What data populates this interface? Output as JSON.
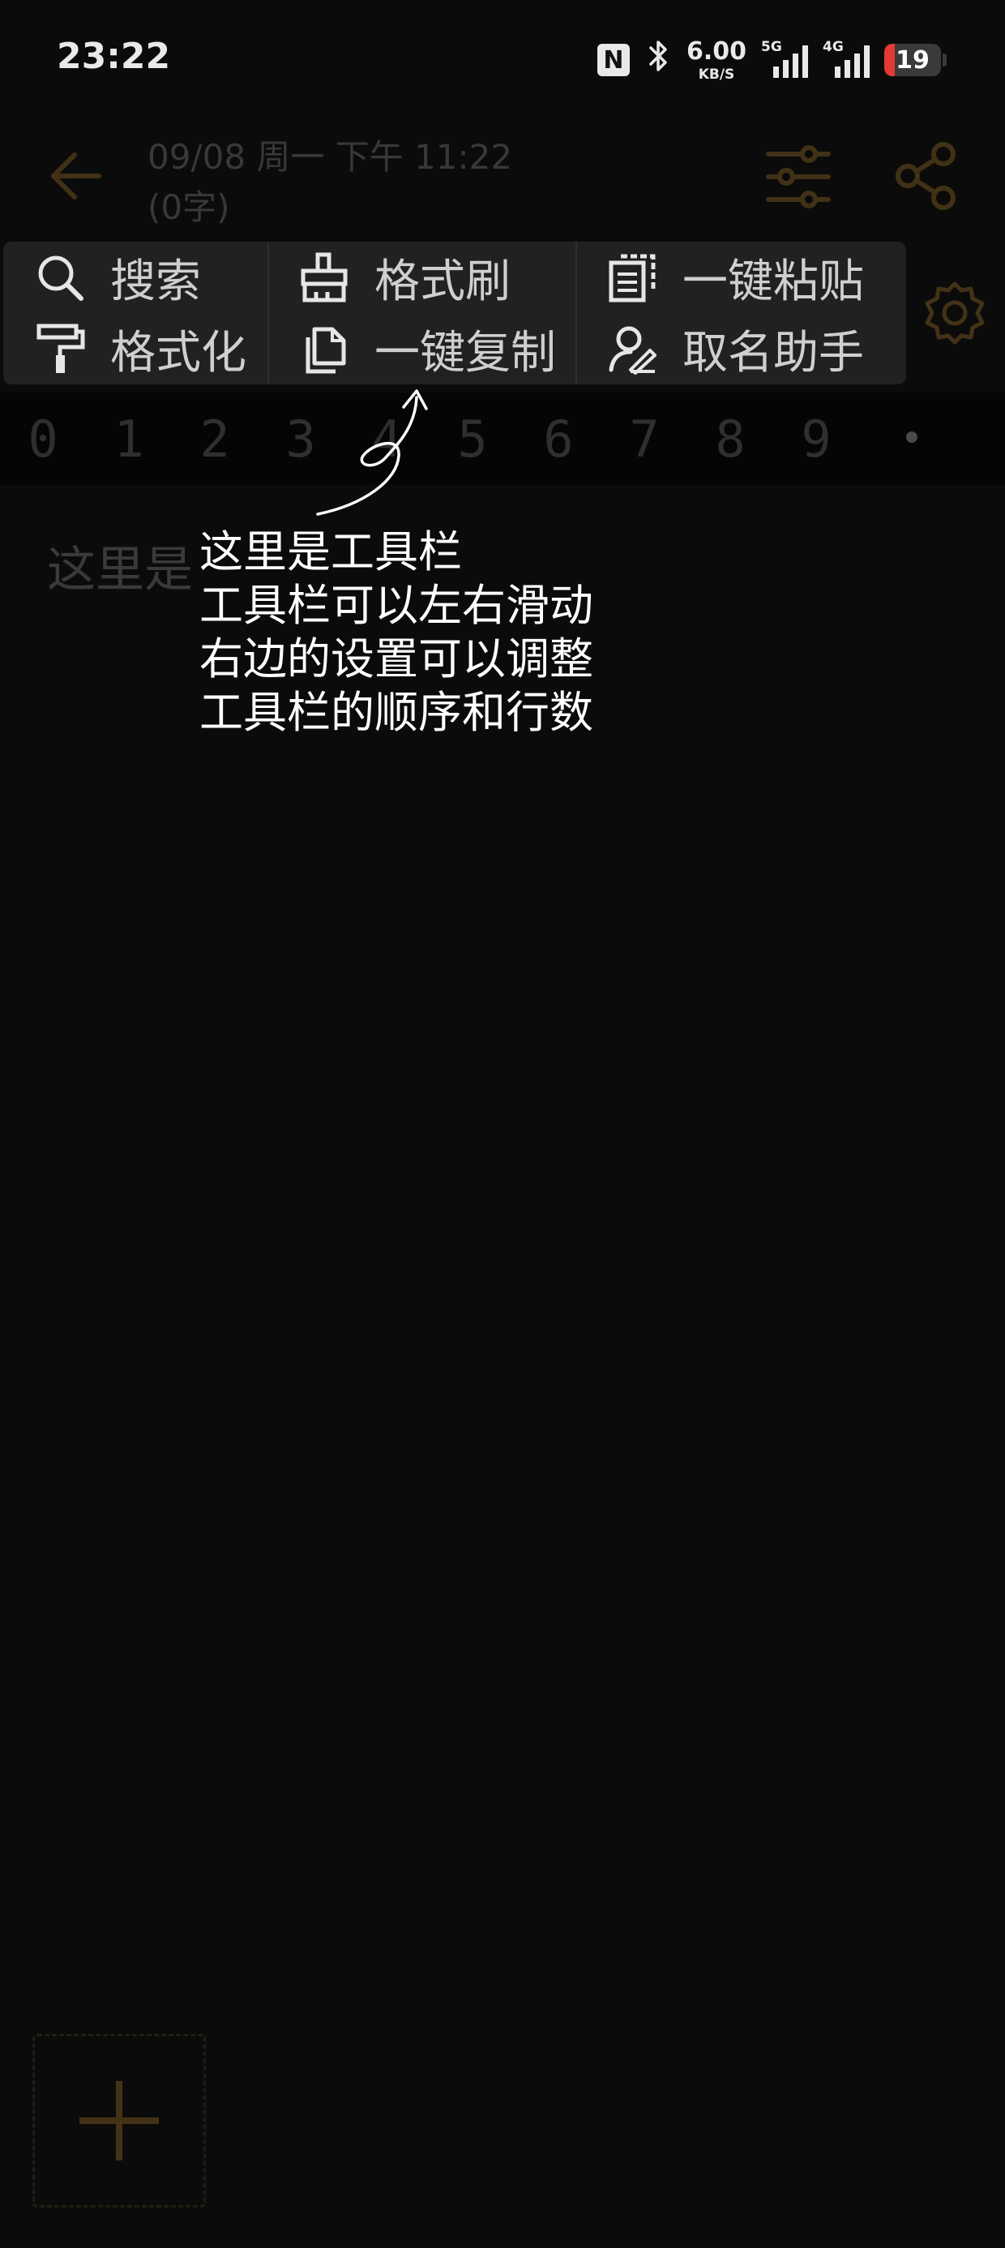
{
  "status_bar": {
    "time": "23:22",
    "nfc": "N",
    "net_speed_value": "6.00",
    "net_speed_unit": "KB/S",
    "signal1_label": "5G",
    "signal2_label": "4G",
    "battery": "19",
    "battery_level": 0.19,
    "battery_color": "#e53935"
  },
  "header": {
    "date_line": "09/08 周一 下午 11:22",
    "count_line": "(0字)"
  },
  "toolbar": {
    "items": [
      {
        "label": "搜索",
        "icon": "search-icon"
      },
      {
        "label": "格式化",
        "icon": "paint-roller-icon"
      },
      {
        "label": "格式刷",
        "icon": "format-brush-icon"
      },
      {
        "label": "一键复制",
        "icon": "copy-icon"
      },
      {
        "label": "一键粘贴",
        "icon": "paste-icon"
      },
      {
        "label": "取名助手",
        "icon": "user-edit-icon"
      }
    ]
  },
  "digits": [
    "0",
    "1",
    "2",
    "3",
    "4",
    "5",
    "6",
    "7",
    "8",
    "9",
    "•"
  ],
  "editor": {
    "placeholder_visible": "这里是"
  },
  "tutorial": {
    "lines": [
      "这里是工具栏",
      "工具栏可以左右滑动",
      "右边的设置可以调整",
      "工具栏的顺序和行数"
    ]
  },
  "colors": {
    "accent": "#b8862e",
    "background": "#0b0b0b",
    "toolbar_bg": "#212121"
  }
}
